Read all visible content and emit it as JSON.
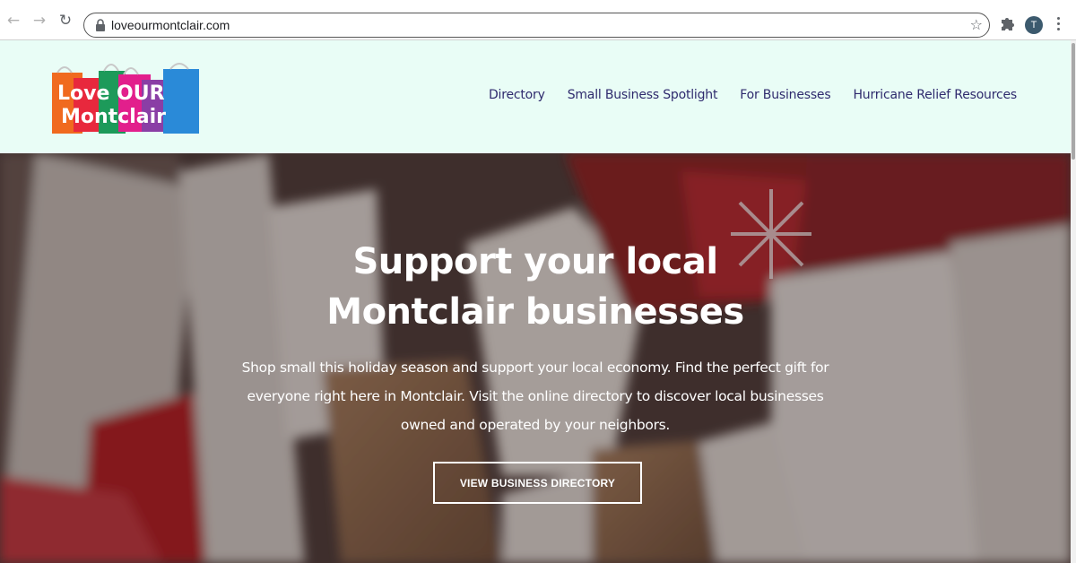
{
  "browser": {
    "url": "loveourmontclair.com",
    "avatar_letter": "T",
    "icons": [
      "back-arrow-icon",
      "forward-arrow-icon",
      "reload-icon",
      "lock-icon",
      "star-icon",
      "puzzle-icon",
      "kebab-menu-icon"
    ]
  },
  "header": {
    "logo_text_line1": "Love OUR",
    "logo_text_line2": "Montclair",
    "nav": [
      {
        "label": "Directory"
      },
      {
        "label": "Small Business Spotlight"
      },
      {
        "label": "For Businesses"
      },
      {
        "label": "Hurricane Relief Resources"
      }
    ],
    "background": "#e9fdf6",
    "nav_color": "#2f2a6e"
  },
  "hero": {
    "title_line1": "Support your local",
    "title_line2": "Montclair businesses",
    "body": "Shop small this holiday season and support your local economy. Find the perfect gift for everyone right here in Montclair. Visit the online directory to discover local businesses owned and operated by your neighbors.",
    "button_label": "VIEW BUSINESS DIRECTORY"
  }
}
